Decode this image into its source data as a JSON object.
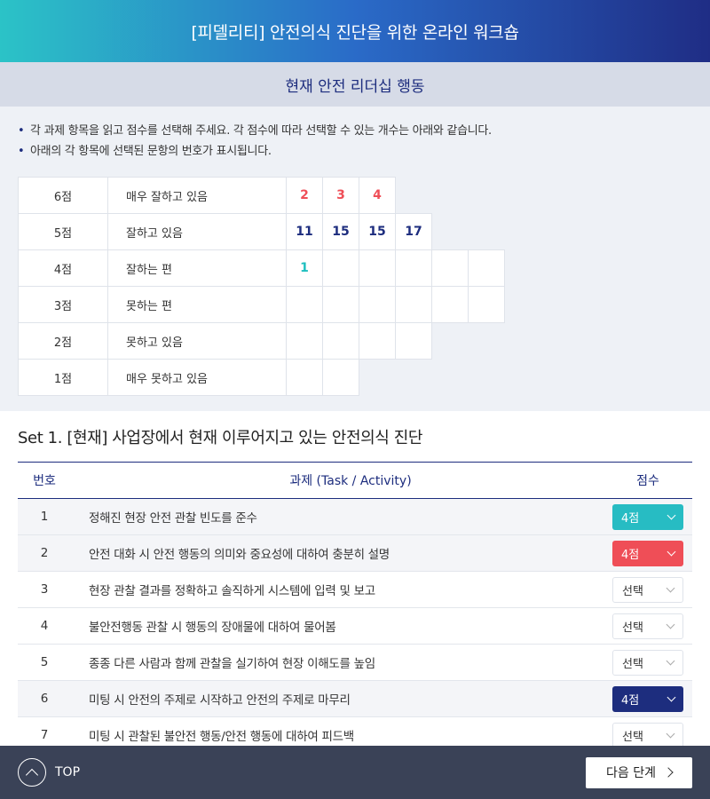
{
  "header": {
    "title": "[피델리티] 안전의식 진단을 위한 온라인 워크숍"
  },
  "subheader": {
    "title": "현재 안전 리더십 행동"
  },
  "notes": [
    "각 과제 항목을 읽고 점수를 선택해 주세요. 각 점수에 따라 선택할 수 있는 개수는 아래와 같습니다.",
    "아래의 각 항목에 선택된 문항의 번호가 표시됩니다."
  ],
  "score_grid": [
    {
      "score": "6점",
      "desc": "매우 잘하고 있음",
      "slots": [
        "2",
        "3",
        "4"
      ],
      "color": "red"
    },
    {
      "score": "5점",
      "desc": "잘하고 있음",
      "slots": [
        "11",
        "15",
        "15",
        "17"
      ],
      "color": "navy"
    },
    {
      "score": "4점",
      "desc": "잘하는 편",
      "slots": [
        "1",
        "",
        "",
        "",
        "",
        ""
      ],
      "color": "teal"
    },
    {
      "score": "3점",
      "desc": "못하는 편",
      "slots": [
        "",
        "",
        "",
        "",
        "",
        ""
      ],
      "color": "navy"
    },
    {
      "score": "2점",
      "desc": "못하고 있음",
      "slots": [
        "",
        "",
        "",
        ""
      ],
      "color": "navy"
    },
    {
      "score": "1점",
      "desc": "매우 못하고 있음",
      "slots": [
        "",
        ""
      ],
      "color": "navy"
    }
  ],
  "set": {
    "title": "Set 1. [현재] 사업장에서 현재 이루어지고 있는 안전의식 진단",
    "headers": {
      "no": "번호",
      "task": "과제 (Task / Activity)",
      "score": "점수"
    },
    "rows": [
      {
        "no": "1",
        "task": "정해진 현장 안전 관찰 빈도를 준수",
        "value": "4점",
        "style": "teal"
      },
      {
        "no": "2",
        "task": "안전 대화 시 안전 행동의 의미와 중요성에 대하여 충분히 설명",
        "value": "4점",
        "style": "red"
      },
      {
        "no": "3",
        "task": "현장 관찰 결과를 정확하고 솔직하게 시스템에 입력 및 보고",
        "value": "선택",
        "style": "empty"
      },
      {
        "no": "4",
        "task": "불안전행동 관찰 시 행동의 장애물에 대하여 물어봄",
        "value": "선택",
        "style": "empty"
      },
      {
        "no": "5",
        "task": "종종 다른 사람과 함께 관찰을 실기하여 현장 이해도를 높임",
        "value": "선택",
        "style": "empty"
      },
      {
        "no": "6",
        "task": "미팅 시 안전의 주제로 시작하고 안전의 주제로 마무리",
        "value": "4점",
        "style": "navy"
      },
      {
        "no": "7",
        "task": "미팅 시 관찰된 불안전 행동/안전 행동에 대하여 피드백",
        "value": "선택",
        "style": "empty"
      }
    ]
  },
  "footer": {
    "top_label": "TOP",
    "next_label": "다음 단계"
  }
}
